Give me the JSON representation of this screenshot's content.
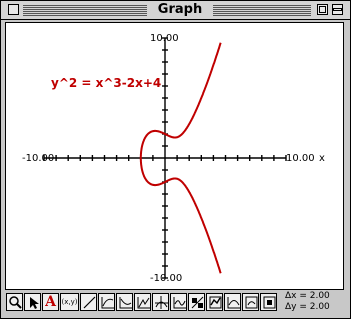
{
  "window": {
    "title": "Graph"
  },
  "graph": {
    "equation": "y^2 = x^3-2x+4",
    "y_max_label": "10.00",
    "y_min_label": "-10.00",
    "x_min_label": "-10.00",
    "x_max_label": "10.00",
    "x_axis_suffix": "x",
    "curve_color": "#c00000"
  },
  "toolbar": {
    "tools": [
      {
        "name": "zoom-tool-icon"
      },
      {
        "name": "pointer-tool-icon"
      },
      {
        "name": "text-tool-icon",
        "glyph": "A"
      },
      {
        "name": "coordinates-tool-icon",
        "glyph": "(x,y)"
      },
      {
        "name": "line-tool-icon"
      },
      {
        "name": "graph-tool-1-icon"
      },
      {
        "name": "graph-tool-2-icon"
      },
      {
        "name": "graph-tool-3-icon"
      },
      {
        "name": "graph-tool-4-icon"
      },
      {
        "name": "graph-tool-5-icon"
      },
      {
        "name": "graph-tool-6-icon"
      },
      {
        "name": "graph-tool-7-icon"
      },
      {
        "name": "graph-tool-8-icon"
      },
      {
        "name": "graph-tool-9-icon"
      },
      {
        "name": "graph-tool-10-icon"
      }
    ],
    "delta_x": "Δx = 2.00",
    "delta_y": "Δy = 2.00"
  }
}
